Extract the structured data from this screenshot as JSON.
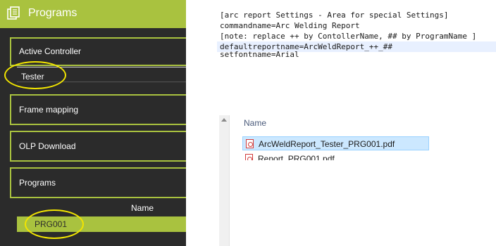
{
  "panel": {
    "title": "Programs",
    "sections": {
      "active_controller": "Active Controller",
      "controller_value": "Tester",
      "frame_mapping": "Frame mapping",
      "olp_download": "OLP Download",
      "programs": "Programs"
    },
    "table": {
      "header": "Name",
      "rows": [
        "PRG001"
      ]
    },
    "accent_color": "#a9c23f",
    "highlight_color": "#f2e500"
  },
  "settings_text": {
    "lines": [
      "[arc report Settings - Area for special Settings]",
      "commandname=Arc Welding Report",
      "[note: replace ++ by ContollerName, ## by ProgramName ]",
      "defaultreportname=ArcWeldReport_++_##",
      "setfontname=Arial"
    ]
  },
  "explorer": {
    "column_header": "Name",
    "files": [
      {
        "name": "ArcWeldReport_Tester_PRG001.pdf",
        "icon": "pdf-icon",
        "selected": true
      },
      {
        "name": "Report_PRG001.pdf",
        "icon": "pdf-icon",
        "selected": false
      }
    ]
  }
}
